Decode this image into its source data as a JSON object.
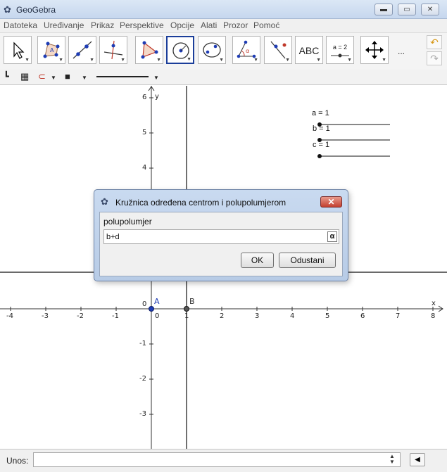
{
  "window": {
    "title": "GeoGebra",
    "app_icon": "geogebra-icon",
    "controls": [
      "minimize-icon",
      "maximize-icon",
      "close-icon"
    ]
  },
  "menu": [
    "Datoteka",
    "Uređivanje",
    "Prikaz",
    "Perspektive",
    "Opcije",
    "Alati",
    "Prozor",
    "Pomoć"
  ],
  "toolbar": {
    "tools": [
      {
        "name": "move-tool-icon"
      },
      {
        "name": "polygon-tool-icon"
      },
      {
        "name": "line-tool-icon"
      },
      {
        "name": "perpendicular-tool-icon"
      },
      {
        "name": "triangle-tool-icon"
      },
      {
        "name": "circle-center-radius-tool-icon",
        "selected": true
      },
      {
        "name": "ellipse-tool-icon"
      },
      {
        "name": "angle-tool-icon",
        "text": "α"
      },
      {
        "name": "reflect-tool-icon"
      },
      {
        "name": "text-tool-icon",
        "text": "ABC"
      },
      {
        "name": "slider-tool-icon",
        "text": "a = 2"
      },
      {
        "name": "move-graphics-tool-icon"
      }
    ],
    "more_label": "...",
    "undo_icon": "undo-icon",
    "redo_icon": "redo-icon"
  },
  "stylebar": {
    "icons": [
      "axes-icon",
      "grid-icon",
      "point-capture-icon",
      "color-icon",
      "line-style-icon"
    ]
  },
  "graphics": {
    "x_axis_label": "x",
    "y_axis_label": "y",
    "x_ticks": [
      "-4",
      "-3",
      "-2",
      "-1",
      "0",
      "1",
      "2",
      "3",
      "4",
      "5",
      "6",
      "7",
      "8"
    ],
    "y_ticks": [
      "6",
      "5",
      "4",
      "-1",
      "-2",
      "-3"
    ],
    "origin_label": "0",
    "points": [
      {
        "label": "A",
        "color": "#1e3cb4"
      },
      {
        "label": "B",
        "color": "#333333"
      }
    ],
    "sliders": [
      {
        "label": "a = 1"
      },
      {
        "label": "b = 1"
      },
      {
        "label": "c = 1"
      }
    ]
  },
  "dialog": {
    "title": "Kružnica određena centrom i polupolumjerom",
    "field_label": "polupolumjer",
    "field_value": "b+d",
    "alpha_label": "α",
    "ok_label": "OK",
    "cancel_label": "Odustani"
  },
  "inputbar": {
    "label": "Unos:",
    "value": ""
  }
}
